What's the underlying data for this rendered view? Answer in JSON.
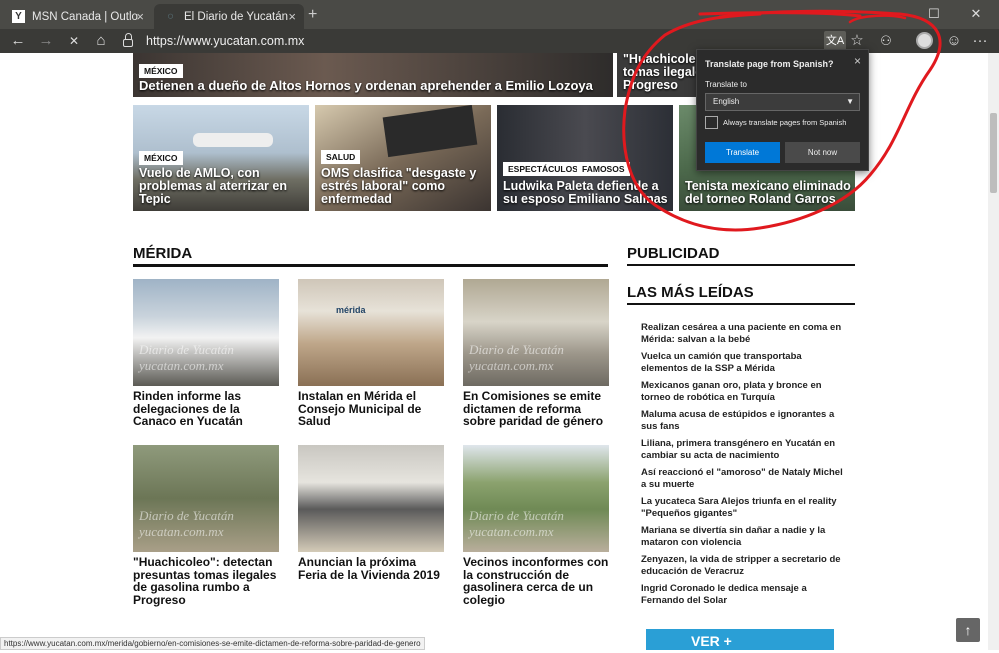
{
  "browser": {
    "tabs": [
      {
        "title": "MSN Canada | Outlook, Office, S",
        "close": "×"
      },
      {
        "title": "El Diario de Yucatán - Noticias d",
        "close": "×"
      }
    ],
    "new_tab": "+",
    "window_controls": {
      "minimize": "—",
      "maximize": "☐",
      "close": "✕"
    },
    "nav": {
      "back": "←",
      "forward": "→",
      "stop": "✕",
      "home": "⌂"
    },
    "url": "https://www.yucatan.com.mx",
    "toolbar_icons": {
      "favorite": "☆",
      "extension": "⚇",
      "emoji": "☺",
      "more": "···"
    }
  },
  "translate_popup": {
    "title": "Translate page from Spanish?",
    "close": "×",
    "translate_to_label": "Translate to",
    "language": "English",
    "always_label": "Always translate pages from Spanish",
    "translate_button": "Translate",
    "not_now_button": "Not now"
  },
  "top_stories": [
    {
      "tag": "MÉXICO",
      "caption": "Detienen a dueño de Altos Hornos y ordenan aprehender a Emilio Lozoya"
    },
    {
      "tag": "",
      "caption": "\"Huachicoleo\" tomas ilegales Progreso"
    },
    {
      "tag": "MÉXICO",
      "caption": "Vuelo de AMLO, con problemas al aterrizar en Tepic"
    },
    {
      "tag": "SALUD",
      "caption": "OMS clasifica \"desgaste y estrés laboral\" como enfermedad"
    },
    {
      "tag": "ESPECTÁCULOS",
      "tag2": "FAMOSOS",
      "caption": "Ludwika Paleta defiende a su esposo Emiliano Salinas"
    },
    {
      "tag": "",
      "caption": "Tenista mexicano eliminado del torneo Roland Garros"
    }
  ],
  "merida": {
    "heading": "MÉRIDA",
    "watermark1": "Diario de Yucatán",
    "watermark2": "yucatan.com.mx",
    "merida_sign": "mérida",
    "articles": [
      {
        "title": "Rinden informe las delegaciones de la Canaco en Yucatán"
      },
      {
        "title": "Instalan en Mérida el Consejo Municipal de Salud"
      },
      {
        "title": "En Comisiones se emite dictamen de reforma sobre paridad de género"
      },
      {
        "title": "\"Huachicoleo\": detectan presuntas tomas ilegales de gasolina rumbo a Progreso"
      },
      {
        "title": "Anuncian la próxima Feria de la Vivienda 2019"
      },
      {
        "title": "Vecinos inconformes con la construcción de gasolinera cerca de un colegio"
      }
    ]
  },
  "sidebar": {
    "publicidad": "PUBLICIDAD",
    "mas_leidas": "LAS MÁS LEÍDAS",
    "items": [
      "Realizan cesárea a una paciente en coma en Mérida: salvan a la bebé",
      "Vuelca un camión que transportaba elementos de la SSP a Mérida",
      "Mexicanos ganan oro, plata y bronce en torneo de robótica en Turquía",
      "Maluma acusa de estúpidos e ignorantes a sus fans",
      "Liliana, primera transgénero en Yucatán en cambiar su acta de nacimiento",
      "Así reaccionó el \"amoroso\" de Nataly Michel a su muerte",
      "La yucateca Sara Alejos triunfa en el reality \"Pequeños gigantes\"",
      "Mariana se divertía sin dañar a nadie y la mataron con violencia",
      "Zenyazen, la vida de stripper a secretario de educación de Veracruz",
      "Ingrid Coronado le dedica mensaje a Fernando del Solar"
    ],
    "ad_text": "VER +"
  },
  "status_url": "https://www.yucatan.com.mx/merida/gobierno/en-comisiones-se-emite-dictamen-de-reforma-sobre-paridad-de-genero",
  "scroll_top": "↑",
  "colors": {
    "accent": "#0078d7",
    "annotation": "#e0191e",
    "tabbar": "#4a4a46"
  }
}
